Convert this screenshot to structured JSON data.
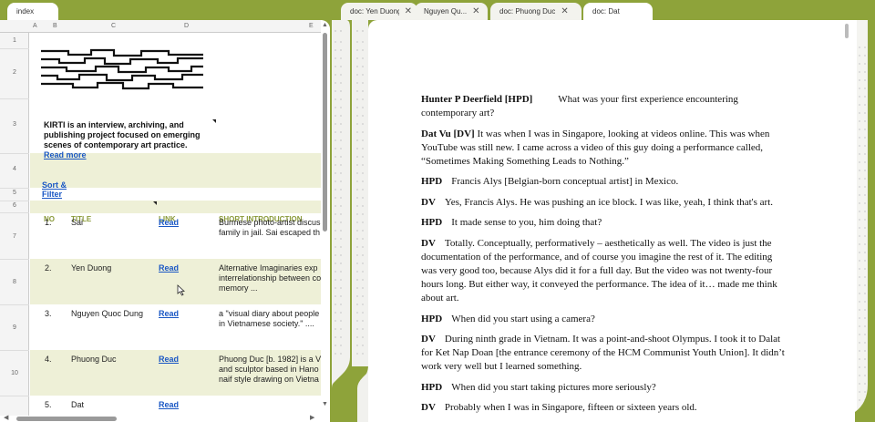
{
  "tabs": [
    {
      "label": "index",
      "closable": false
    },
    {
      "label": "doc: Yen Duong",
      "closable": true
    },
    {
      "label": "Nguyen Qu...",
      "closable": true
    },
    {
      "label": "doc: Phuong Duc",
      "closable": true
    },
    {
      "label": "doc: Dat",
      "closable": false
    }
  ],
  "sheet": {
    "columns": [
      "A",
      "B",
      "C",
      "D",
      "E"
    ],
    "rows": [
      "1",
      "2",
      "3",
      "4",
      "5",
      "6",
      "7",
      "8",
      "9",
      "10"
    ],
    "about_lines": [
      "KIRTI is an interview, archiving, and",
      "publishing project focused on emerging",
      "scenes of contemporary art practice."
    ],
    "read_more": "Read more",
    "sort_filter": "Sort & Filter",
    "headers": {
      "no": "NO",
      "title": "TITLE",
      "link": "LINK",
      "intro": "SHORT INTRODUCTION"
    },
    "entries": [
      {
        "no": "1.",
        "title": "Sai",
        "link": "Read",
        "intro": [
          "Burmese photo-artist discus",
          "family in jail. Sai escaped th"
        ]
      },
      {
        "no": "2.",
        "title": "Yen Duong",
        "link": "Read",
        "intro": [
          "Alternative Imaginaries exp",
          "interrelationship between co",
          "memory ..."
        ]
      },
      {
        "no": "3.",
        "title": "Nguyen Quoc Dung",
        "link": "Read",
        "intro": [
          "a \"visual diary about people",
          "in Vietnamese society.\" ...."
        ]
      },
      {
        "no": "4.",
        "title": "Phuong Duc",
        "link": "Read",
        "intro": [
          "Phuong Duc [b. 1982] is a V",
          "and sculptor based in Hano",
          "naif style drawing on Vietna"
        ]
      },
      {
        "no": "5.",
        "title": "Dat",
        "link": "Read",
        "intro": []
      }
    ]
  },
  "document": {
    "paragraphs": [
      {
        "speaker": "Hunter P Deerfield [HPD]",
        "text": "What was your first experience encountering contemporary art?",
        "wide_gap": true
      },
      {
        "speaker": "Dat Vu [DV]",
        "text": "It was when I was in Singapore, looking at videos online. This was when YouTube was still new. I came across a video of this guy doing a performance called, “Sometimes Making Something Leads to Nothing.”"
      },
      {
        "speaker": "HPD",
        "text": "Francis Alys [Belgian-born conceptual artist] in Mexico."
      },
      {
        "speaker": "DV",
        "text": "Yes, Francis Alys. He was pushing an ice block. I was like, yeah, I think that's art."
      },
      {
        "speaker": "HPD",
        "text": "It made sense to you, him doing that?"
      },
      {
        "speaker": "DV",
        "text": "Totally. Conceptually, performatively – aesthetically as well. The video is just the documentation of the performance, and of course you imagine the rest of it. The editing was very good too, because Alys did it for a full day. But the video was not twenty-four hours long. But either way, it conveyed the performance. The idea of it… made me think about art."
      },
      {
        "speaker": "HPD",
        "text": "When did you start using a camera?"
      },
      {
        "speaker": "DV",
        "text": "During ninth grade in Vietnam. It was a point-and-shoot Olympus. I took it to Dalat for Ket Nap Doan [the entrance ceremony of the HCM Communist Youth Union]. It didn’t work very well but I learned something."
      },
      {
        "speaker": "HPD",
        "text": "When did you start taking pictures more seriously?"
      },
      {
        "speaker": "DV",
        "text": "Probably when I was in Singapore, fifteen or sixteen years old."
      }
    ]
  },
  "colors": {
    "frame": "#8ea33a",
    "band": "#eef0d7",
    "link": "#1a57c4",
    "header": "#8a9a3a"
  }
}
